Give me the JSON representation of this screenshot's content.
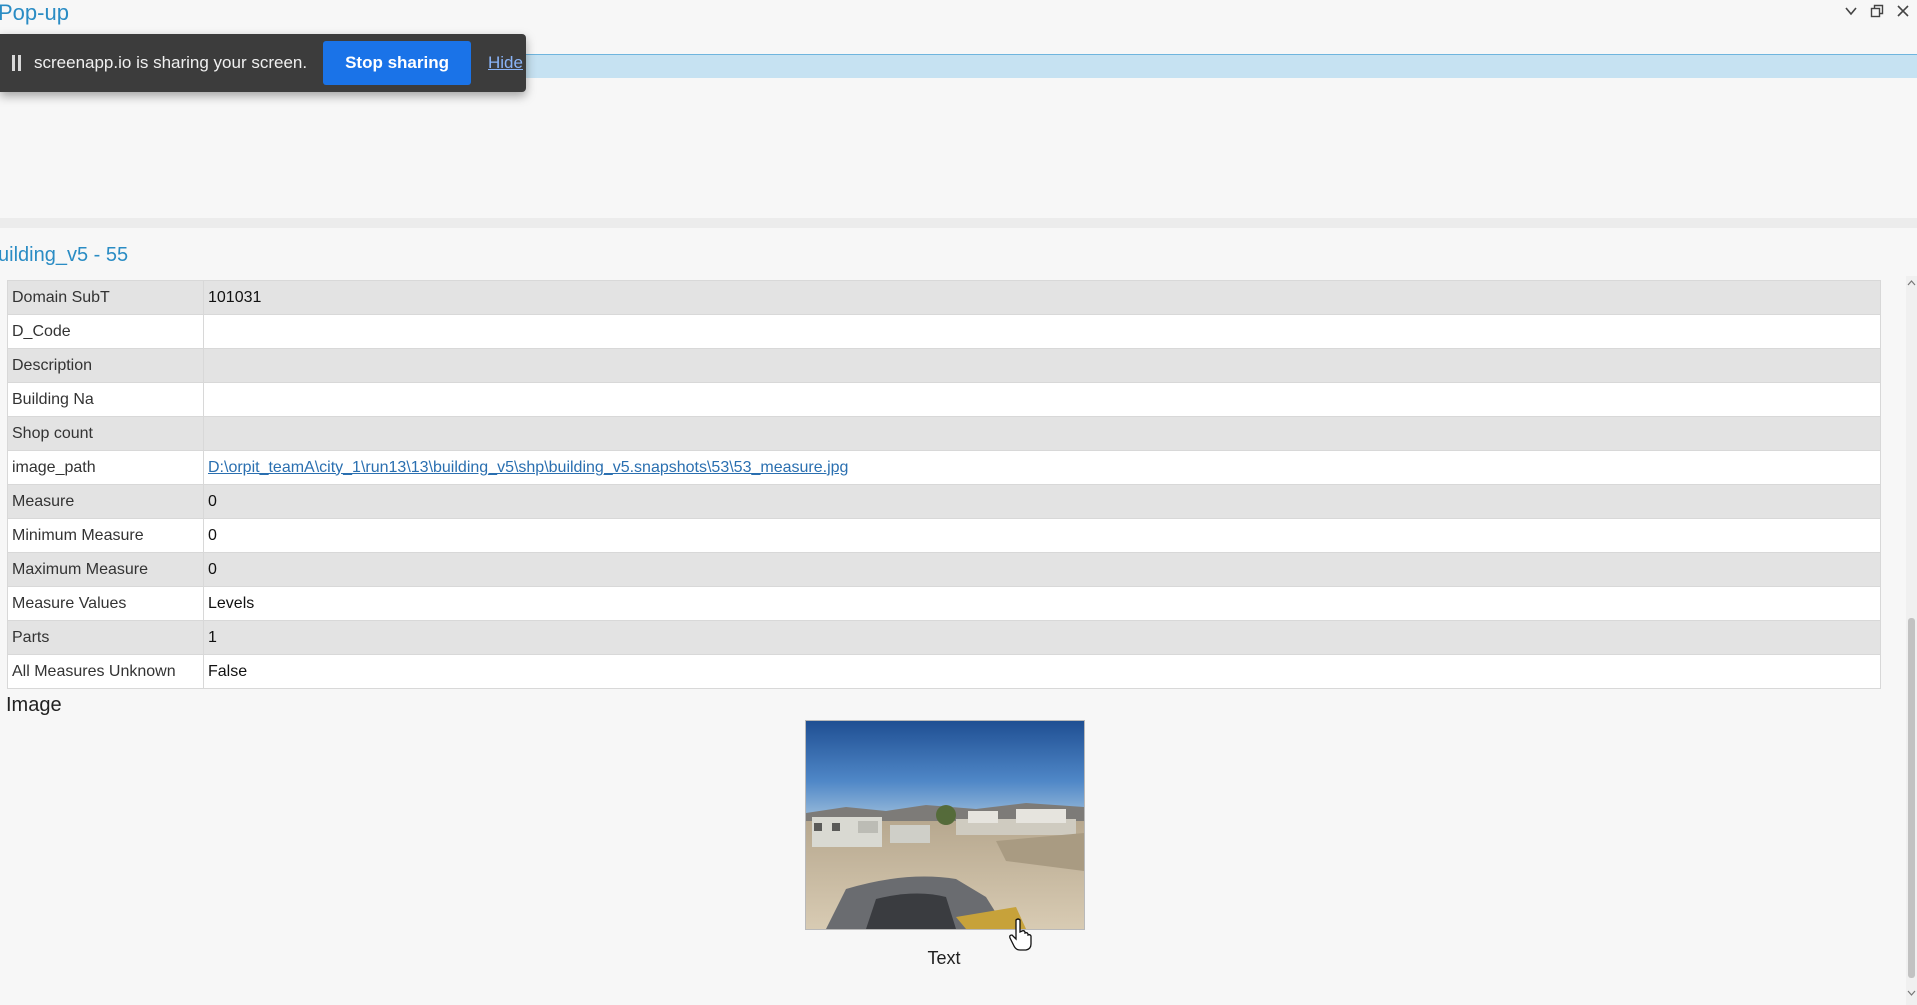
{
  "pane": {
    "title": "Pop-up",
    "collapse_icon": "chevron-down-icon",
    "restore_icon": "restore-window-icon",
    "close_icon": "close-icon"
  },
  "sharing_notice": {
    "message": "screenapp.io is sharing your screen.",
    "stop_label": "Stop sharing",
    "hide_label": "Hide",
    "stop_color": "#1a73e8"
  },
  "feature": {
    "title": "uilding_v5 - 55"
  },
  "attributes": [
    {
      "field": "Domain SubT",
      "value": "101031"
    },
    {
      "field": "D_Code",
      "value": ""
    },
    {
      "field": "Description",
      "value": ""
    },
    {
      "field": "Building Na",
      "value": ""
    },
    {
      "field": "Shop count",
      "value": ""
    },
    {
      "field": "image_path",
      "value": "D:\\orpit_teamA\\city_1\\run13\\13\\building_v5\\shp\\building_v5.snapshots\\53\\53_measure.jpg"
    },
    {
      "field": "Measure",
      "value": "0"
    },
    {
      "field": "Minimum Measure",
      "value": "0"
    },
    {
      "field": "Maximum Measure",
      "value": "0"
    },
    {
      "field": "Measure Values",
      "value": "Levels"
    },
    {
      "field": "Parts",
      "value": "1"
    },
    {
      "field": "All Measures Unknown",
      "value": "False"
    }
  ],
  "image_section": {
    "heading": "Image",
    "caption": "Text"
  },
  "colors": {
    "accent": "#2a8cc4",
    "selection": "#c6e2f2"
  }
}
